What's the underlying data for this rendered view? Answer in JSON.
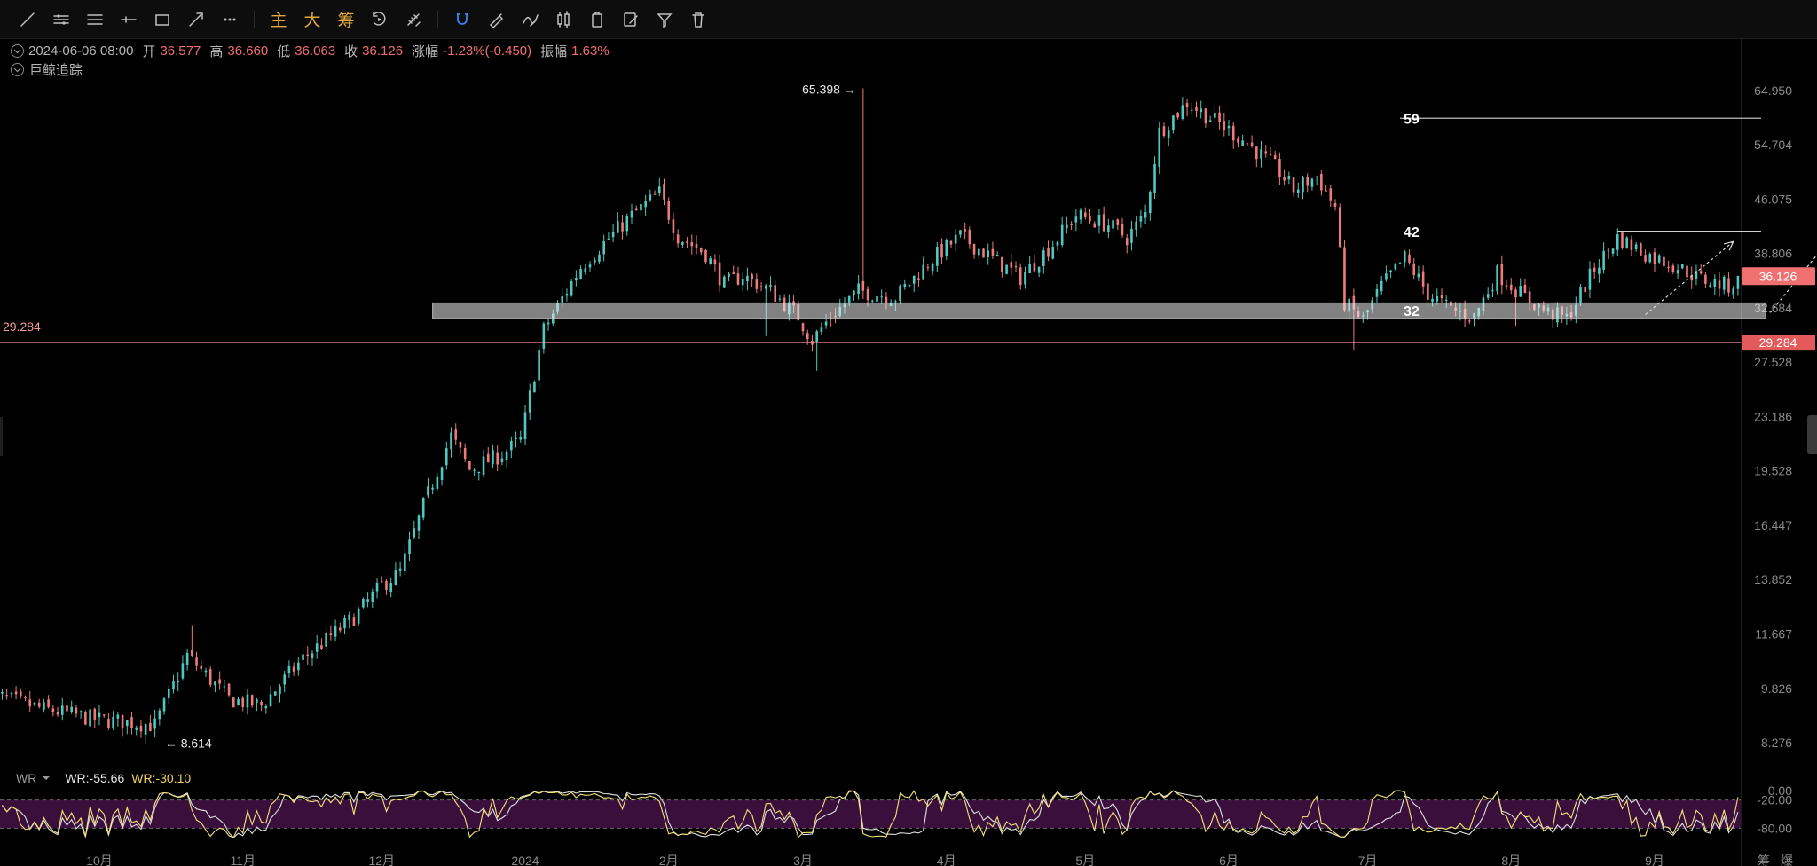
{
  "toolbar": {
    "tools": [
      "trend-line-icon",
      "parallel-channel-icon",
      "horizontal-lines-icon",
      "horizontal-ray-icon",
      "rectangle-icon",
      "arrow-line-icon",
      "more-icon"
    ],
    "text_tools": [
      {
        "name": "main-indicator-button",
        "label": "主"
      },
      {
        "name": "large-order-button",
        "label": "大"
      },
      {
        "name": "chip-distribution-button",
        "label": "筹"
      }
    ],
    "tools2": [
      "replay-icon",
      "measure-icon"
    ],
    "tools3": [
      "magnet-icon",
      "brush-icon",
      "candles-icon",
      "clipboard-icon",
      "edit-chart-icon",
      "rotate-icon",
      "filter-icon",
      "trash-icon"
    ]
  },
  "info": {
    "date": "2024-06-06 08:00",
    "open_label": "开",
    "open": "36.577",
    "high_label": "高",
    "high": "36.660",
    "low_label": "低",
    "low": "36.063",
    "close_label": "收",
    "close": "36.126",
    "change_label": "涨幅",
    "change": "-1.23%(-0.450)",
    "amp_label": "振幅",
    "amp": "1.63%",
    "indicator": "巨鲸追踪"
  },
  "wr": {
    "name": "WR",
    "v1": "WR:-55.66",
    "v2": "WR:-30.10"
  },
  "colors": {
    "up": "#4fc9c0",
    "down": "#ef7a7a",
    "line": "#f09a9a",
    "wr_band": "#3a0f3c",
    "wr1": "#e0e0e0",
    "wr2": "#f5e37a"
  },
  "chart_data": {
    "type": "candlestick",
    "y_scale": "log",
    "y_ticks": [
      "64.950",
      "54.704",
      "46.075",
      "38.806",
      "32.684",
      "27.528",
      "23.186",
      "19.528",
      "16.447",
      "13.852",
      "11.667",
      "9.826",
      "8.276"
    ],
    "y_tick_values": [
      64.95,
      54.704,
      46.075,
      38.806,
      32.684,
      27.528,
      23.186,
      19.528,
      16.447,
      13.852,
      11.667,
      9.826,
      8.276
    ],
    "x_labels": [
      "10月",
      "11月",
      "12月",
      "2024",
      "2月",
      "3月",
      "4月",
      "5月",
      "6月",
      "7月",
      "8月",
      "9月"
    ],
    "x_label_dates": [
      "2023-10-01",
      "2023-11-01",
      "2023-12-01",
      "2024-01-01",
      "2024-02-01",
      "2024-03-01",
      "2024-04-01",
      "2024-05-01",
      "2024-06-01",
      "2024-07-01",
      "2024-08-01",
      "2024-09-01"
    ],
    "corner_labels": [
      "筹",
      "爆"
    ],
    "last_price": "36.126",
    "price_line": {
      "value": 29.284,
      "label": "29.284"
    },
    "markers": {
      "high": {
        "label": "65.398",
        "value": 65.398,
        "date": "2024-03-14"
      },
      "low": {
        "label": "8.614",
        "value": 8.614,
        "date": "2023-10-14"
      }
    },
    "anchors": [
      {
        "date": "2023-09-07",
        "close": 9.7
      },
      {
        "date": "2023-09-20",
        "close": 9.2
      },
      {
        "date": "2023-10-02",
        "close": 8.9
      },
      {
        "date": "2023-10-14",
        "close": 8.75
      },
      {
        "date": "2023-10-21",
        "close": 10.9
      },
      {
        "date": "2023-10-30",
        "close": 9.5
      },
      {
        "date": "2023-11-06",
        "close": 9.3
      },
      {
        "date": "2023-11-15",
        "close": 10.8
      },
      {
        "date": "2023-11-26",
        "close": 12.3
      },
      {
        "date": "2023-12-02",
        "close": 13.6
      },
      {
        "date": "2023-12-06",
        "close": 14.2
      },
      {
        "date": "2023-12-11",
        "close": 17.5
      },
      {
        "date": "2023-12-17",
        "close": 21.8
      },
      {
        "date": "2023-12-21",
        "close": 19.6
      },
      {
        "date": "2023-12-28",
        "close": 20.6
      },
      {
        "date": "2024-01-01",
        "close": 21.5
      },
      {
        "date": "2024-01-06",
        "close": 30.5
      },
      {
        "date": "2024-01-14",
        "close": 37.2
      },
      {
        "date": "2024-01-24",
        "close": 43.2
      },
      {
        "date": "2024-01-31",
        "close": 47.0
      },
      {
        "date": "2024-02-04",
        "close": 41.0
      },
      {
        "date": "2024-02-10",
        "close": 38.8
      },
      {
        "date": "2024-02-14",
        "close": 35.2
      },
      {
        "date": "2024-02-18",
        "close": 36.2
      },
      {
        "date": "2024-02-24",
        "close": 34.5
      },
      {
        "date": "2024-03-01",
        "close": 31.8
      },
      {
        "date": "2024-03-04",
        "close": 29.5
      },
      {
        "date": "2024-03-08",
        "close": 31.8
      },
      {
        "date": "2024-03-14",
        "close": 34.5
      },
      {
        "date": "2024-03-22",
        "close": 33.8
      },
      {
        "date": "2024-03-30",
        "close": 38.2
      },
      {
        "date": "2024-04-05",
        "close": 41.0
      },
      {
        "date": "2024-04-12",
        "close": 38.2
      },
      {
        "date": "2024-04-18",
        "close": 36.0
      },
      {
        "date": "2024-04-25",
        "close": 40.0
      },
      {
        "date": "2024-04-30",
        "close": 43.8
      },
      {
        "date": "2024-05-07",
        "close": 42.5
      },
      {
        "date": "2024-05-11",
        "close": 40.8
      },
      {
        "date": "2024-05-15",
        "close": 44.0
      },
      {
        "date": "2024-05-18",
        "close": 57.0
      },
      {
        "date": "2024-05-24",
        "close": 62.5
      },
      {
        "date": "2024-05-31",
        "close": 58.5
      },
      {
        "date": "2024-06-06",
        "close": 55.0
      },
      {
        "date": "2024-06-12",
        "close": 51.0
      },
      {
        "date": "2024-06-16",
        "close": 47.5
      },
      {
        "date": "2024-06-21",
        "close": 49.5
      },
      {
        "date": "2024-06-25",
        "close": 45.0
      },
      {
        "date": "2024-06-27",
        "close": 33.2
      },
      {
        "date": "2024-07-01",
        "close": 31.5
      },
      {
        "date": "2024-07-05",
        "close": 35.0
      },
      {
        "date": "2024-07-10",
        "close": 38.3
      },
      {
        "date": "2024-07-15",
        "close": 34.2
      },
      {
        "date": "2024-07-20",
        "close": 32.5
      },
      {
        "date": "2024-07-25",
        "close": 31.8
      },
      {
        "date": "2024-07-30",
        "close": 36.5
      },
      {
        "date": "2024-08-05",
        "close": 33.8
      },
      {
        "date": "2024-08-10",
        "close": 32.2
      },
      {
        "date": "2024-08-14",
        "close": 31.6
      },
      {
        "date": "2024-08-20",
        "close": 37.0
      },
      {
        "date": "2024-08-25",
        "close": 40.8
      },
      {
        "date": "2024-09-01",
        "close": 38.5
      },
      {
        "date": "2024-09-06",
        "close": 37.5
      },
      {
        "date": "2024-09-12",
        "close": 35.8
      },
      {
        "date": "2024-09-18",
        "close": 35.0
      },
      {
        "date": "2024-09-22",
        "close": 36.126
      }
    ],
    "wr_range": [
      -100,
      0
    ],
    "wr_levels": [
      {
        "value": 0,
        "label": "0.00"
      },
      {
        "value": -20,
        "label": "-20.00"
      },
      {
        "value": -80,
        "label": "-80.00"
      }
    ],
    "annotations": [
      {
        "kind": "box",
        "label": "32",
        "y_low": 31.6,
        "y_high": 33.2,
        "from": "2023-12-12",
        "to": "2024-09-25"
      },
      {
        "kind": "hline",
        "label": "42",
        "value": 41.6,
        "from": "2024-08-24",
        "to": "2024-09-24"
      },
      {
        "kind": "hline",
        "label": "59",
        "value": 59.5,
        "from": "2024-07-08",
        "to": "2024-09-24"
      },
      {
        "kind": "arrow",
        "from_date": "2024-08-30",
        "from_value": 32.0,
        "to_date": "2024-09-18",
        "to_value": 40.3
      },
      {
        "kind": "arrow",
        "from_date": "2024-09-26",
        "from_value": 32.2,
        "to_date": "2024-10-28",
        "to_value": 57.5
      }
    ]
  }
}
